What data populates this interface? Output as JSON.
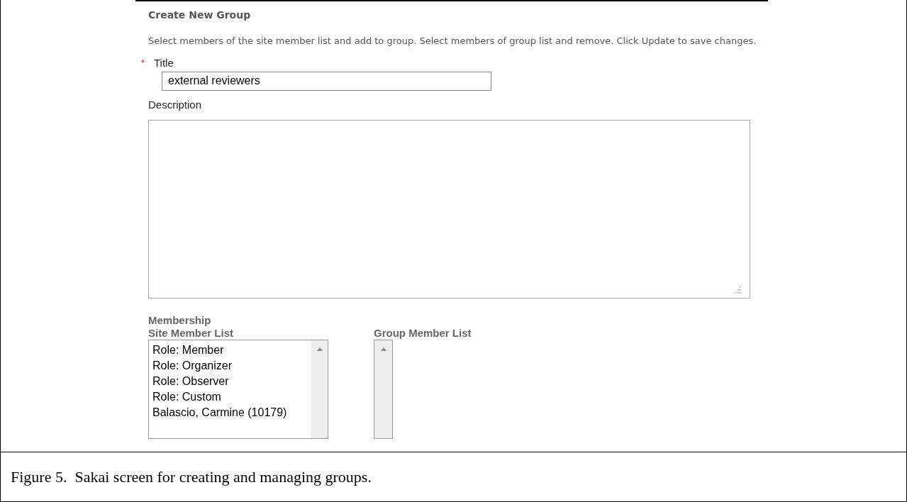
{
  "form": {
    "heading": "Create New Group",
    "instructions": "Select members of the site member list and add to group. Select members of group list and remove. Click Update to save changes.",
    "title_field": {
      "label": "Title",
      "required_mark": "*",
      "value": "external reviewers"
    },
    "description_field": {
      "label": "Description"
    },
    "membership": {
      "heading": "Membership",
      "site_member_list": {
        "label": "Site Member List",
        "items": [
          "Role: Member",
          "Role: Organizer",
          "Role: Observer",
          "Role: Custom",
          "Balascio, Carmine (10179)"
        ]
      },
      "group_member_list": {
        "label": "Group Member List"
      }
    }
  },
  "caption": "Figure 5.  Sakai screen for creating and managing groups."
}
